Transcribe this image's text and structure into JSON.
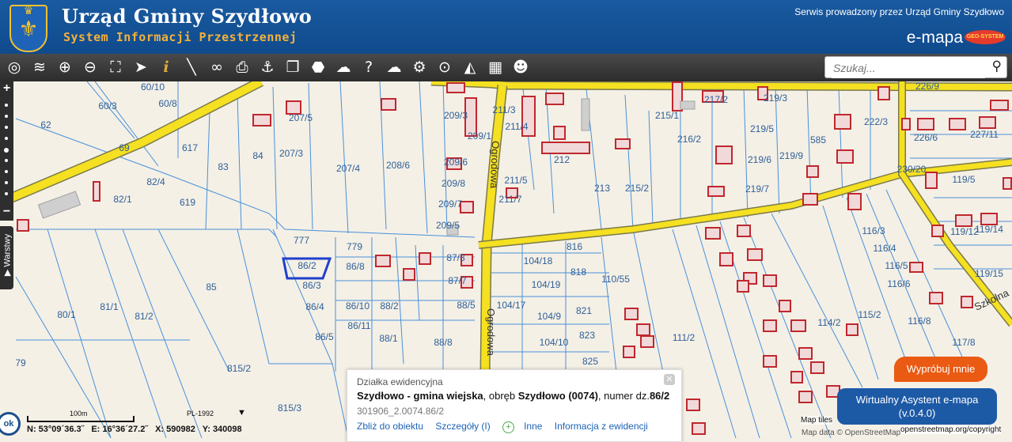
{
  "header": {
    "title": "Urząd Gminy Szydłowo",
    "subtitle": "System Informacji Przestrzennej",
    "service_note": "Serwis prowadzony przez Urząd Gminy Szydłowo",
    "brand": "e-mapa",
    "brand_badge": "GEO-SYSTEM"
  },
  "toolbar": {
    "tools": [
      {
        "name": "map-globe-icon",
        "glyph": "◎"
      },
      {
        "name": "layers-icon",
        "glyph": "≋"
      },
      {
        "name": "zoom-in-icon",
        "glyph": "⊕"
      },
      {
        "name": "zoom-out-icon",
        "glyph": "⊖"
      },
      {
        "name": "zoom-extent-icon",
        "glyph": "⛶"
      },
      {
        "name": "pointer-icon",
        "glyph": "➤"
      },
      {
        "name": "info-icon",
        "glyph": "i"
      },
      {
        "name": "measure-icon",
        "glyph": "╲"
      },
      {
        "name": "link-icon",
        "glyph": "∞"
      },
      {
        "name": "print-icon",
        "glyph": "⎙"
      },
      {
        "name": "anchor-icon",
        "glyph": "⚓"
      },
      {
        "name": "copy-icon",
        "glyph": "❐"
      },
      {
        "name": "shape-icon",
        "glyph": "⬣"
      },
      {
        "name": "comment-icon",
        "glyph": "☁"
      },
      {
        "name": "help-icon",
        "glyph": "?"
      },
      {
        "name": "cloud-download-icon",
        "glyph": "☁"
      },
      {
        "name": "settings-icon",
        "glyph": "⚙"
      },
      {
        "name": "search-area-icon",
        "glyph": "⊙"
      },
      {
        "name": "triangles-icon",
        "glyph": "◭"
      },
      {
        "name": "color-grid-icon",
        "glyph": "▦"
      },
      {
        "name": "users-icon",
        "glyph": "☻"
      }
    ],
    "search_placeholder": "Szukaj..."
  },
  "sidebar": {
    "zoom_in": "+",
    "zoom_out": "−",
    "layers_label": "▶ Warstwy"
  },
  "map": {
    "labels": [
      [
        "60/10",
        193,
        114
      ],
      [
        "60/3",
        136,
        138
      ],
      [
        "60/8",
        212,
        135
      ],
      [
        "62",
        58,
        162
      ],
      [
        "69",
        157,
        191
      ],
      [
        "617",
        240,
        191
      ],
      [
        "83",
        282,
        215
      ],
      [
        "84",
        326,
        201
      ],
      [
        "82/4",
        197,
        234
      ],
      [
        "82/1",
        155,
        256
      ],
      [
        "619",
        237,
        260
      ],
      [
        "207/5",
        380,
        153
      ],
      [
        "207/3",
        368,
        198
      ],
      [
        "207/4",
        440,
        217
      ],
      [
        "208/6",
        503,
        213
      ],
      [
        "209/3",
        576,
        150
      ],
      [
        "209/6",
        576,
        209
      ],
      [
        "209/8",
        573,
        236
      ],
      [
        "209/7",
        569,
        262
      ],
      [
        "209/5",
        566,
        289
      ],
      [
        "211/3",
        637,
        143
      ],
      [
        "211/4",
        653,
        164
      ],
      [
        "209/1",
        606,
        176
      ],
      [
        "211/5",
        652,
        232
      ],
      [
        "211/7",
        645,
        256
      ],
      [
        "212",
        710,
        206
      ],
      [
        "213",
        761,
        242
      ],
      [
        "215/2",
        805,
        242
      ],
      [
        "216/2",
        871,
        180
      ],
      [
        "215/1",
        843,
        150
      ],
      [
        "217/2",
        905,
        130
      ],
      [
        "219/3",
        980,
        128
      ],
      [
        "219/5",
        963,
        167
      ],
      [
        "219/6",
        960,
        206
      ],
      [
        "219/9",
        1000,
        201
      ],
      [
        "219/7",
        957,
        243
      ],
      [
        "222/3",
        1107,
        158
      ],
      [
        "226/9",
        1172,
        113
      ],
      [
        "226/6",
        1170,
        178
      ],
      [
        "227/11",
        1244,
        174
      ],
      [
        "585",
        1034,
        181
      ],
      [
        "777",
        381,
        308
      ],
      [
        "779",
        448,
        316
      ],
      [
        "86/2",
        388,
        340
      ],
      [
        "86/3",
        394,
        365
      ],
      [
        "86/8",
        449,
        341
      ],
      [
        "86/4",
        398,
        392
      ],
      [
        "86/5",
        410,
        430
      ],
      [
        "86/10",
        452,
        391
      ],
      [
        "86/11",
        454,
        416
      ],
      [
        "88/2",
        492,
        391
      ],
      [
        "88/1",
        491,
        432
      ],
      [
        "88/8",
        560,
        437
      ],
      [
        "87/3",
        576,
        330
      ],
      [
        "87/7",
        578,
        359
      ],
      [
        "88/5",
        589,
        390
      ],
      [
        "85",
        267,
        367
      ],
      [
        "81/1",
        138,
        392
      ],
      [
        "81/2",
        182,
        404
      ],
      [
        "80/1",
        84,
        402
      ],
      [
        "79",
        26,
        463
      ],
      [
        "815/2",
        302,
        470
      ],
      [
        "815/3",
        366,
        520
      ],
      [
        "816",
        726,
        316
      ],
      [
        "818",
        731,
        348
      ],
      [
        "104/18",
        680,
        334
      ],
      [
        "104/19",
        690,
        364
      ],
      [
        "104/17",
        646,
        390
      ],
      [
        "104/9",
        694,
        404
      ],
      [
        "104/10",
        700,
        437
      ],
      [
        "821",
        738,
        397
      ],
      [
        "823",
        742,
        428
      ],
      [
        "825",
        746,
        461
      ],
      [
        "110/55",
        778,
        357
      ],
      [
        "111/2",
        864,
        431
      ],
      [
        "114/2",
        1048,
        412
      ],
      [
        "115/2",
        1099,
        402
      ],
      [
        "116/4",
        1118,
        318
      ],
      [
        "116/5",
        1133,
        340
      ],
      [
        "116/6",
        1136,
        363
      ],
      [
        "116/8",
        1162,
        410
      ],
      [
        "117/8",
        1218,
        437
      ],
      [
        "119/12",
        1219,
        297
      ],
      [
        "119/14",
        1250,
        294
      ],
      [
        "119/15",
        1250,
        350
      ],
      [
        "116/3",
        1104,
        296
      ],
      [
        "230/20",
        1152,
        218
      ],
      [
        "119/5",
        1218,
        231
      ]
    ],
    "parcel_selected": "86/2",
    "streets": [
      "Ogrodowa",
      "Ogrodowa",
      "Szkolna"
    ]
  },
  "popup": {
    "title": "Działka ewidencyjna",
    "gmina": "Szydłowo - gmina wiejska",
    "obreb_label": "obręb",
    "obreb": "Szydłowo (0074)",
    "numer_label": "numer dz.",
    "numer": "86/2",
    "identifier": "301906_2.0074.86/2",
    "links": {
      "zoom": "Zbliż do obiektu",
      "details": "Szczegóły (I)",
      "other": "Inne",
      "registry": "Informacja z ewidencji"
    }
  },
  "status": {
    "ok": "ok",
    "scale": "100m",
    "crs": "PL-1992",
    "lat": "N: 53°09´36.3˝",
    "lon": "E: 16°36´27.2˝",
    "x": "X: 590982",
    "y": "Y: 340098"
  },
  "assistant": {
    "try": "Wypróbuj mnie",
    "name": "Wirtualny Asystent e-mapa",
    "version": "(v.0.4.0)"
  },
  "attribution": {
    "tiles": "Map tiles",
    "data": "Map data © OpenStreetMap",
    "url": "openstreetmap.org/copyright"
  },
  "colors": {
    "header_bg": "#0f4a8c",
    "road": "#f5e021",
    "parcel_line": "#4a90d9",
    "selected_parcel": "#1f3fcc",
    "building": "#c0272d",
    "assistant": "#1d5aa6",
    "try_button": "#ea5a12"
  }
}
